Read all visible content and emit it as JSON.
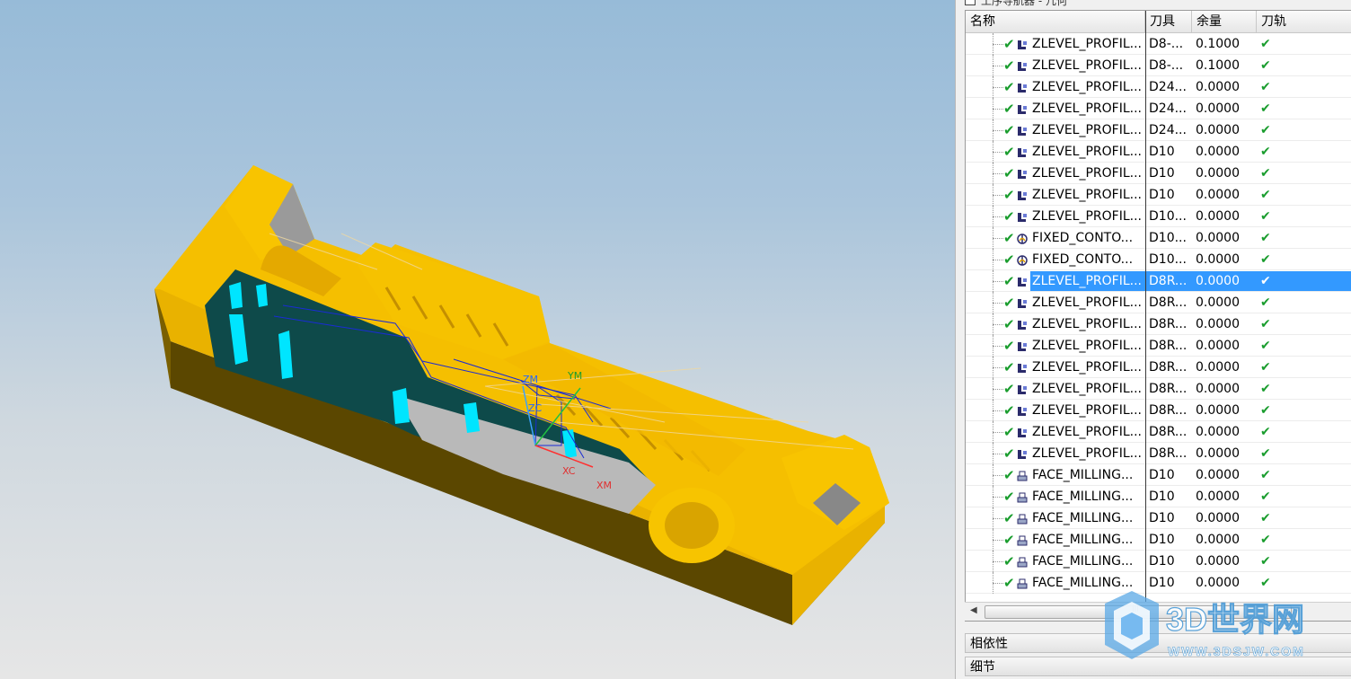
{
  "panel": {
    "title": "工序导航器 - 几何",
    "columns": {
      "name": "名称",
      "tool": "刀具",
      "stock": "余量",
      "path": "刀轨"
    },
    "rows": [
      {
        "name": "ZLEVEL_PROFIL...",
        "tool": "D8-...",
        "stock": "0.1000",
        "path": "✔",
        "icon": "zlevel-profile-icon"
      },
      {
        "name": "ZLEVEL_PROFIL...",
        "tool": "D8-...",
        "stock": "0.1000",
        "path": "✔",
        "icon": "zlevel-profile-icon"
      },
      {
        "name": "ZLEVEL_PROFIL...",
        "tool": "D24...",
        "stock": "0.0000",
        "path": "✔",
        "icon": "zlevel-profile-icon"
      },
      {
        "name": "ZLEVEL_PROFIL...",
        "tool": "D24...",
        "stock": "0.0000",
        "path": "✔",
        "icon": "zlevel-profile-icon"
      },
      {
        "name": "ZLEVEL_PROFIL...",
        "tool": "D24...",
        "stock": "0.0000",
        "path": "✔",
        "icon": "zlevel-profile-icon"
      },
      {
        "name": "ZLEVEL_PROFIL...",
        "tool": "D10",
        "stock": "0.0000",
        "path": "✔",
        "icon": "zlevel-profile-icon"
      },
      {
        "name": "ZLEVEL_PROFIL...",
        "tool": "D10",
        "stock": "0.0000",
        "path": "✔",
        "icon": "zlevel-profile-icon"
      },
      {
        "name": "ZLEVEL_PROFIL...",
        "tool": "D10",
        "stock": "0.0000",
        "path": "✔",
        "icon": "zlevel-profile-icon"
      },
      {
        "name": "ZLEVEL_PROFIL...",
        "tool": "D10...",
        "stock": "0.0000",
        "path": "✔",
        "icon": "zlevel-profile-icon"
      },
      {
        "name": "FIXED_CONTO...",
        "tool": "D10...",
        "stock": "0.0000",
        "path": "✔",
        "icon": "fixed-contour-icon"
      },
      {
        "name": "FIXED_CONTO...",
        "tool": "D10...",
        "stock": "0.0000",
        "path": "✔",
        "icon": "fixed-contour-icon"
      },
      {
        "name": "ZLEVEL_PROFIL...",
        "tool": "D8R...",
        "stock": "0.0000",
        "path": "✔",
        "icon": "zlevel-profile-icon",
        "selected": true
      },
      {
        "name": "ZLEVEL_PROFIL...",
        "tool": "D8R...",
        "stock": "0.0000",
        "path": "✔",
        "icon": "zlevel-profile-icon"
      },
      {
        "name": "ZLEVEL_PROFIL...",
        "tool": "D8R...",
        "stock": "0.0000",
        "path": "✔",
        "icon": "zlevel-profile-icon"
      },
      {
        "name": "ZLEVEL_PROFIL...",
        "tool": "D8R...",
        "stock": "0.0000",
        "path": "✔",
        "icon": "zlevel-profile-icon"
      },
      {
        "name": "ZLEVEL_PROFIL...",
        "tool": "D8R...",
        "stock": "0.0000",
        "path": "✔",
        "icon": "zlevel-profile-icon"
      },
      {
        "name": "ZLEVEL_PROFIL...",
        "tool": "D8R...",
        "stock": "0.0000",
        "path": "✔",
        "icon": "zlevel-profile-icon"
      },
      {
        "name": "ZLEVEL_PROFIL...",
        "tool": "D8R...",
        "stock": "0.0000",
        "path": "✔",
        "icon": "zlevel-profile-icon"
      },
      {
        "name": "ZLEVEL_PROFIL...",
        "tool": "D8R...",
        "stock": "0.0000",
        "path": "✔",
        "icon": "zlevel-profile-icon"
      },
      {
        "name": "ZLEVEL_PROFIL...",
        "tool": "D8R...",
        "stock": "0.0000",
        "path": "✔",
        "icon": "zlevel-profile-icon"
      },
      {
        "name": "FACE_MILLING...",
        "tool": "D10",
        "stock": "0.0000",
        "path": "✔",
        "icon": "face-milling-icon"
      },
      {
        "name": "FACE_MILLING...",
        "tool": "D10",
        "stock": "0.0000",
        "path": "✔",
        "icon": "face-milling-icon"
      },
      {
        "name": "FACE_MILLING...",
        "tool": "D10",
        "stock": "0.0000",
        "path": "✔",
        "icon": "face-milling-icon"
      },
      {
        "name": "FACE_MILLING...",
        "tool": "D10",
        "stock": "0.0000",
        "path": "✔",
        "icon": "face-milling-icon"
      },
      {
        "name": "FACE_MILLING...",
        "tool": "D10",
        "stock": "0.0000",
        "path": "✔",
        "icon": "face-milling-icon"
      },
      {
        "name": "FACE_MILLING...",
        "tool": "D10",
        "stock": "0.0000",
        "path": "✔",
        "icon": "face-milling-icon"
      }
    ],
    "scroll_grip": "III",
    "sections": {
      "dependencies": "相依性",
      "details": "细节"
    }
  },
  "viewport": {
    "axes": {
      "zm": "ZM",
      "ym": "YM",
      "zc": "ZC",
      "xc": "XC",
      "xm": "XM"
    },
    "colors": {
      "part": "#f5b800",
      "part_shadow": "#5a4500",
      "cavity": "#0e4a4a",
      "highlight": "#00e5ff",
      "toolpath": "#1a2bd6"
    }
  },
  "watermark": {
    "brand": "3D世界网",
    "url": "WWW.3DSJW.COM"
  }
}
